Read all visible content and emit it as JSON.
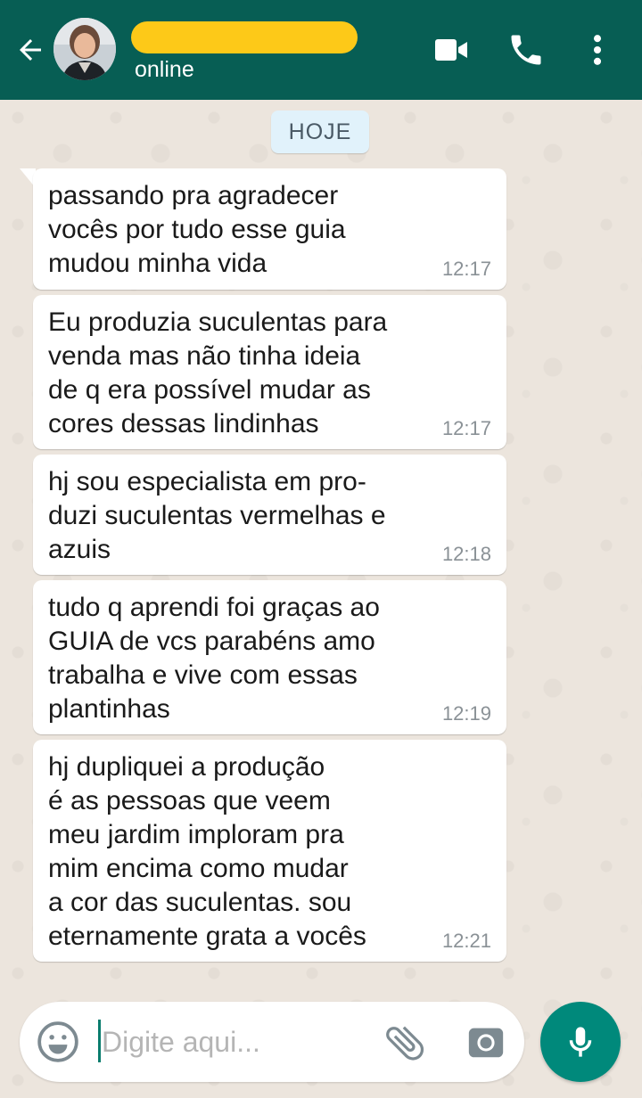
{
  "header": {
    "status": "online",
    "colors": {
      "bar": "#075e54",
      "name_redaction": "#fdc918"
    },
    "icons": [
      "back-arrow-icon",
      "video-call-icon",
      "phone-icon",
      "more-vert-icon"
    ]
  },
  "date_chip": "HOJE",
  "messages": [
    {
      "text": "passando pra agradecer\nvocês por tudo esse guia\nmudou minha vida",
      "time": "12:17"
    },
    {
      "text": "Eu produzia suculentas para\nvenda mas não tinha ideia\nde q era possível mudar as\ncores dessas lindinhas",
      "time": "12:17"
    },
    {
      "text": "hj sou especialista em pro-\nduzi suculentas vermelhas e\nazuis",
      "time": "12:18"
    },
    {
      "text": "tudo q aprendi foi graças ao\nGUIA de vcs parabéns amo\ntrabalha e vive com essas\nplantinhas",
      "time": "12:19"
    },
    {
      "text": "hj dupliquei a produção\né as pessoas que veem\nmeu jardim imploram pra\nmim encima como mudar\na cor das suculentas. sou\neternamente grata a vocês",
      "time": "12:21"
    }
  ],
  "composer": {
    "placeholder": "Digite aqui...",
    "icons": [
      "emoji-icon",
      "attach-icon",
      "camera-icon",
      "mic-icon"
    ],
    "colors": {
      "mic_button": "#00897b"
    }
  }
}
